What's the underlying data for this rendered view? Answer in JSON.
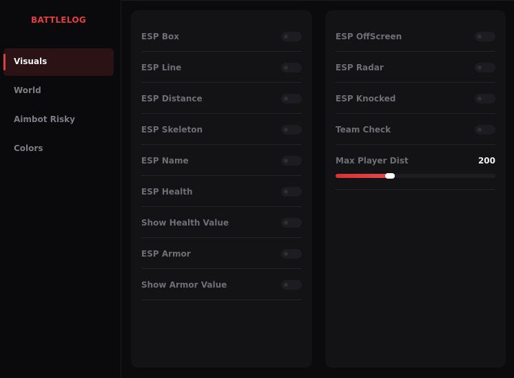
{
  "brand": "BATTLELOG",
  "nav": {
    "items": [
      {
        "label": "Visuals",
        "active": true
      },
      {
        "label": "World"
      },
      {
        "label": "Aimbot Risky"
      },
      {
        "label": "Colors"
      }
    ]
  },
  "left_panel": {
    "toggles": [
      {
        "label": "ESP Box",
        "on": false
      },
      {
        "label": "ESP Line",
        "on": false
      },
      {
        "label": "ESP Distance",
        "on": false
      },
      {
        "label": "ESP Skeleton",
        "on": false
      },
      {
        "label": "ESP Name",
        "on": false
      },
      {
        "label": "ESP Health",
        "on": false
      },
      {
        "label": "Show Health Value",
        "on": false
      },
      {
        "label": "ESP Armor",
        "on": false
      },
      {
        "label": "Show Armor Value",
        "on": false
      }
    ]
  },
  "right_panel": {
    "toggles": [
      {
        "label": "ESP OffScreen",
        "on": false
      },
      {
        "label": "ESP Radar",
        "on": false
      },
      {
        "label": "ESP Knocked",
        "on": false
      },
      {
        "label": "Team Check",
        "on": false
      }
    ],
    "slider": {
      "label": "Max Player Dist",
      "value": "200",
      "fraction": 0.34
    }
  },
  "colors": {
    "accent": "#e0403f",
    "active_bg": "#2b1214",
    "panel_bg": "#131316"
  }
}
